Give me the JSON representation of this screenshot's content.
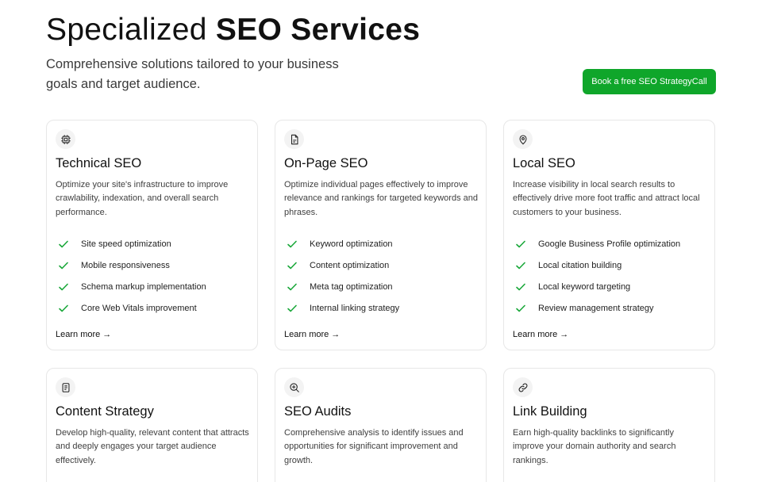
{
  "header": {
    "title_regular": "Specialized ",
    "title_bold": "SEO Services",
    "subtitle": "Comprehensive solutions tailored to your business goals and target audience.",
    "cta_label": "Book a free SEO StrategyCall"
  },
  "colors": {
    "accent": "#0fa62a",
    "check": "#1aa83a"
  },
  "cards": [
    {
      "icon": "cpu-icon",
      "title": "Technical SEO",
      "description": "Optimize your site's infrastructure to improve crawlability, indexation, and overall search performance.",
      "features": [
        "Site speed optimization",
        "Mobile responsiveness",
        "Schema markup implementation",
        "Core Web Vitals improvement"
      ],
      "link": "Learn more →"
    },
    {
      "icon": "document-icon",
      "title": "On-Page SEO",
      "description": "Optimize individual pages effectively to improve relevance and rankings for targeted keywords and phrases.",
      "features": [
        "Keyword optimization",
        "Content optimization",
        "Meta tag optimization",
        "Internal linking strategy"
      ],
      "link": "Learn more →"
    },
    {
      "icon": "map-pin-icon",
      "title": "Local SEO",
      "description": "Increase visibility in local search results to effectively drive more foot traffic and attract local customers to your business.",
      "features": [
        "Google Business Profile optimization",
        "Local citation building",
        "Local keyword targeting",
        "Review management strategy"
      ],
      "link": "Learn more →"
    },
    {
      "icon": "notepad-icon",
      "title": "Content Strategy",
      "description": "Develop high-quality, relevant content that attracts and deeply engages your target audience effectively."
    },
    {
      "icon": "zoom-in-icon",
      "title": "SEO Audits",
      "description": "Comprehensive analysis to identify issues and opportunities for significant improvement and growth."
    },
    {
      "icon": "link-icon",
      "title": "Link Building",
      "description": "Earn high-quality backlinks to significantly improve your domain authority and search rankings."
    }
  ]
}
